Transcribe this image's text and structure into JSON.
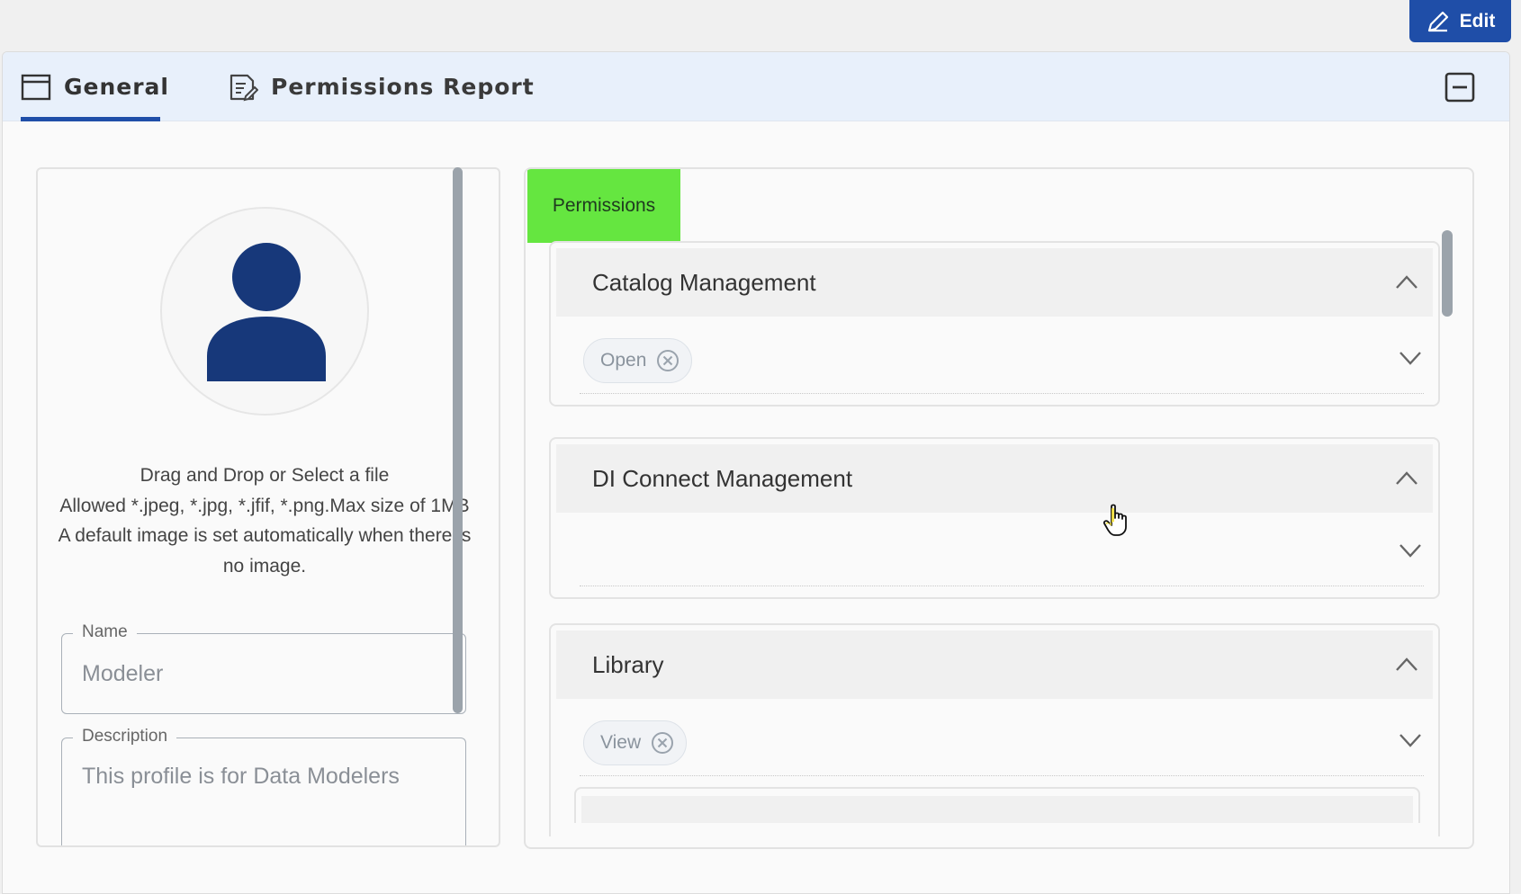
{
  "header": {
    "edit_label": "Edit"
  },
  "tabs": [
    {
      "label": "General",
      "icon": "window-icon",
      "active": true
    },
    {
      "label": "Permissions Report",
      "icon": "report-icon",
      "active": false
    }
  ],
  "profile": {
    "upload_lines": [
      "Drag and Drop or Select a file",
      "Allowed *.jpeg, *.jpg, *.jfif, *.png.Max size of 1MB",
      "A default image is set automatically when there is no image."
    ],
    "name_label": "Name",
    "name_value": "Modeler",
    "description_label": "Description",
    "description_value": "This profile is for Data Modelers"
  },
  "permissions": {
    "tab_label": "Permissions",
    "tab_color": "#65e640",
    "sections": [
      {
        "title": "Catalog Management",
        "chips": [
          "Open"
        ]
      },
      {
        "title": "DI Connect Management",
        "chips": []
      },
      {
        "title": "Library",
        "chips": [
          "View"
        ]
      }
    ]
  },
  "colors": {
    "accent": "#1f4ea8",
    "tabbar_bg": "#e8f0fb",
    "avatar": "#17387a"
  }
}
